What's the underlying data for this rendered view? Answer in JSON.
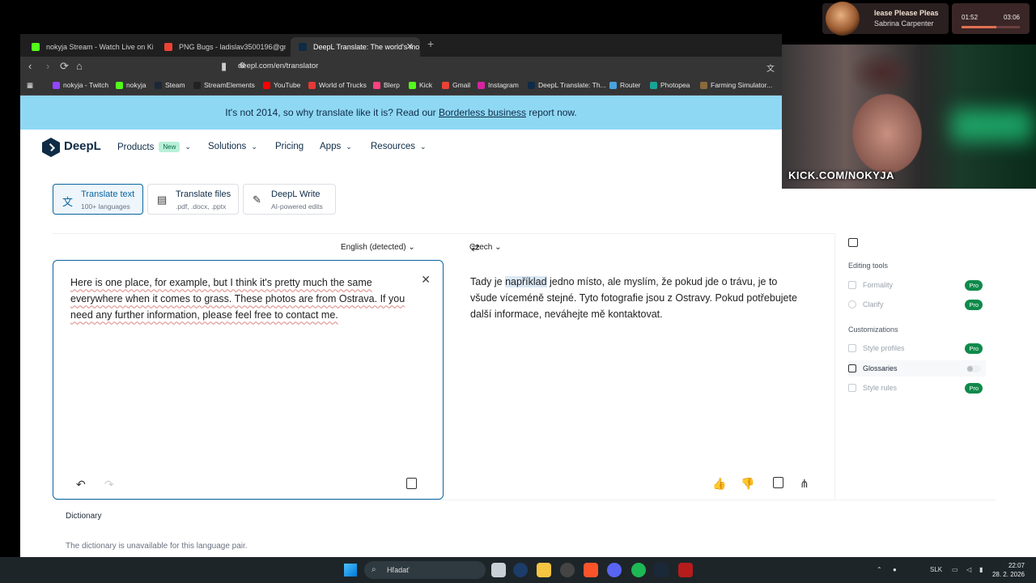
{
  "media": {
    "song": "lease Please Pleas",
    "artist": "Sabrina Carpenter",
    "time_elapsed": "01:52",
    "time_total": "03:06",
    "progress": 0.6
  },
  "browser": {
    "tabs": [
      {
        "title": "nokyja Stream - Watch Live on Kick",
        "active": false
      },
      {
        "title": "PNG Bugs - ladislav3500196@gmail.",
        "active": false
      },
      {
        "title": "DeepL Translate: The world's mo",
        "active": true
      }
    ],
    "url": "deepl.com/en/translator",
    "bookmarks": [
      "nokyja - Twitch",
      "nokyja",
      "Steam",
      "StreamElements",
      "YouTube",
      "World of Trucks",
      "Blerp",
      "Kick",
      "Gmail",
      "Instagram",
      "DeepL Translate: Th...",
      "Router",
      "Photopea",
      "Farming Simulator..."
    ]
  },
  "banner": {
    "text_before": "It's not 2014, so why translate like it is? Read our ",
    "link": "Borderless business",
    "text_after": " report now."
  },
  "header": {
    "brand": "DeepL",
    "menu": {
      "products": "Products",
      "new_badge": "New",
      "solutions": "Solutions",
      "pricing": "Pricing",
      "apps": "Apps",
      "resources": "Resources"
    }
  },
  "modes": [
    {
      "title": "Translate text",
      "sub": "100+ languages"
    },
    {
      "title": "Translate files",
      "sub": ".pdf, .docx, .pptx"
    },
    {
      "title": "DeepL Write",
      "sub": "AI-powered edits"
    }
  ],
  "translator": {
    "source_lang": "English (detected)",
    "target_lang": "Czech",
    "source_text": "Here is one place, for example, but I think it's pretty much the same everywhere when it comes to grass. These photos are from Ostrava. If you need any further information, please feel free to contact me.",
    "target_before": "Tady je ",
    "target_highlight": "například",
    "target_after": " jedno místo, ale myslím, že pokud jde o trávu, je to všude víceméně stejné. Tyto fotografie jsou z Ostravy. Pokud potřebujete další informace, neváhejte mě kontaktovat."
  },
  "side_panel": {
    "editing_tools": "Editing tools",
    "formality": "Formality",
    "clarify": "Clarify",
    "customizations": "Customizations",
    "style_profiles": "Style profiles",
    "glossaries": "Glossaries",
    "style_rules": "Style rules",
    "pro": "Pro"
  },
  "dictionary": {
    "title": "Dictionary",
    "message": "The dictionary is unavailable for this language pair."
  },
  "webcam": {
    "overlay": "KICK.COM/NOKYJA"
  },
  "taskbar": {
    "search": "Hľadať",
    "lang": "SLK",
    "time": "22:07",
    "date": "28. 2. 2026"
  }
}
